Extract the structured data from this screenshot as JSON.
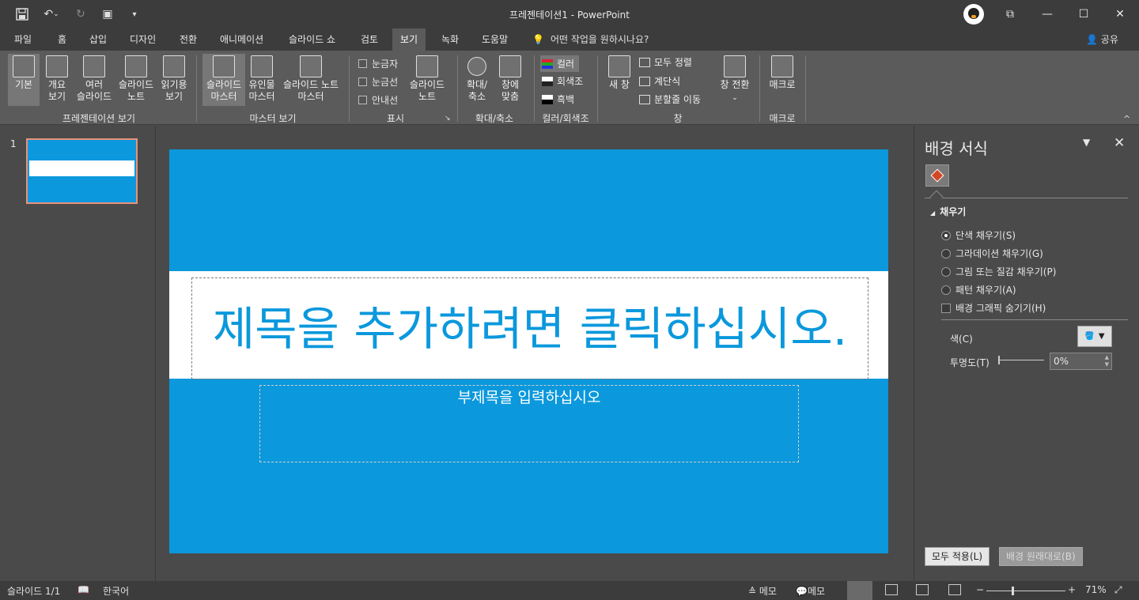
{
  "window": {
    "title": "프레젠테이션1  -  PowerPoint",
    "controls": {
      "restore": "⧉",
      "minimize": "—",
      "maximize": "☐",
      "close": "✕"
    }
  },
  "qat": {
    "save_icon": "💾",
    "undo_icon": "↶",
    "undo_dropdown": "⌄",
    "redo_icon": "↻",
    "start_icon": "▣",
    "more_icon": "▾"
  },
  "tabs": [
    "파일",
    "홈",
    "삽입",
    "디자인",
    "전환",
    "애니메이션",
    "슬라이드 쇼",
    "검토",
    "보기",
    "녹화",
    "도움말"
  ],
  "active_tab": "보기",
  "tell_me": "어떤 작업을 원하시나요?",
  "share": "공유",
  "ribbon": {
    "presentation_views": {
      "label": "프레젠테이션 보기",
      "buttons": [
        "기본",
        "개요\n보기",
        "여러\n슬라이드",
        "슬라이드\n노트",
        "읽기용\n보기"
      ]
    },
    "master_views": {
      "label": "마스터 보기",
      "buttons": [
        "슬라이드\n마스터",
        "유인물\n마스터",
        "슬라이드 노트\n마스터"
      ]
    },
    "show": {
      "label": "표시",
      "checks": [
        "눈금자",
        "눈금선",
        "안내선"
      ],
      "notes_button": "슬라이드\n노트"
    },
    "zoom": {
      "label": "확대/축소",
      "buttons": [
        "확대/\n축소",
        "창에\n맞춤"
      ]
    },
    "color": {
      "label": "컬러/회색조",
      "options": [
        "컬러",
        "회색조",
        "흑백"
      ]
    },
    "window": {
      "label": "창",
      "new_window": "새 창",
      "small": [
        "모두 정렬",
        "계단식",
        "분할줄 이동"
      ],
      "switch": "창 전환"
    },
    "macros": {
      "label": "매크로",
      "button": "매크로"
    },
    "collapse_icon": "^"
  },
  "thumbnails": {
    "slide_number": "1"
  },
  "slide": {
    "title_placeholder": "제목을 추가하려면 클릭하십시오.",
    "subtitle_placeholder": "부제목을 입력하십시오",
    "background_color": "#0b98dc"
  },
  "format_pane": {
    "title": "배경 서식",
    "caret": "▼",
    "close": "✕",
    "section": "채우기",
    "section_caret": "◢",
    "fill_options": [
      "단색 채우기(S)",
      "그라데이션 채우기(G)",
      "그림 또는 질감 채우기(P)",
      "패턴 채우기(A)"
    ],
    "hide_graphics": "배경 그래픽 숨기기(H)",
    "color_label": "색(C)",
    "transparency_label": "투명도(T)",
    "transparency_value": "0%",
    "apply_all": "모두 적용(L)",
    "reset": "배경 원래대로(B)"
  },
  "status": {
    "slide": "슬라이드 1/1",
    "language": "한국어",
    "notes": "메모",
    "comments": "메모",
    "zoom": "71%",
    "zoom_minus": "−",
    "zoom_plus": "+"
  }
}
